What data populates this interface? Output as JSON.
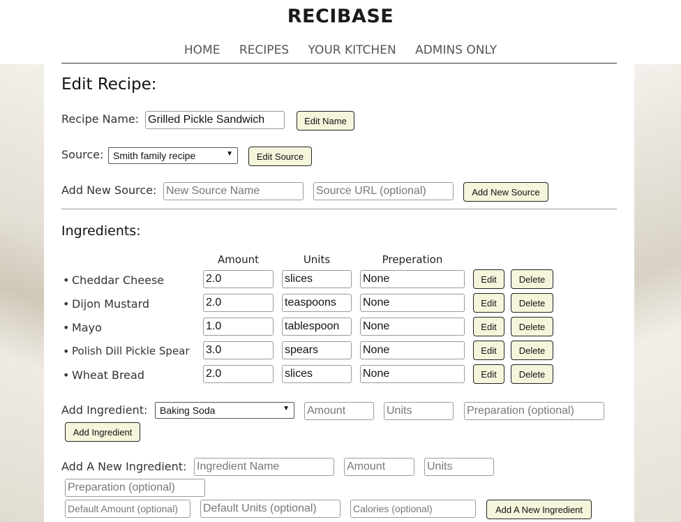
{
  "site": {
    "title": "RECIBASE"
  },
  "nav": {
    "items": [
      "HOME",
      "RECIPES",
      "YOUR KITCHEN",
      "ADMINS ONLY"
    ]
  },
  "page": {
    "heading": "Edit Recipe:"
  },
  "recipe_name": {
    "label": "Recipe Name:",
    "value": "Grilled Pickle Sandwich",
    "button": "Edit Name"
  },
  "source": {
    "label": "Source:",
    "selected": "Smith family recipe",
    "button": "Edit Source"
  },
  "new_source": {
    "label": "Add New Source:",
    "name_placeholder": "New Source Name",
    "url_placeholder": "Source URL (optional)",
    "button": "Add New Source"
  },
  "ingredients": {
    "heading": "Ingredients:",
    "columns": [
      "Amount",
      "Units",
      "Preperation"
    ],
    "edit_label": "Edit",
    "delete_label": "Delete",
    "rows": [
      {
        "name": "Cheddar Cheese",
        "amount": "2.0",
        "units": "slices",
        "prep": "None"
      },
      {
        "name": "Dijon Mustard",
        "amount": "2.0",
        "units": "teaspoons",
        "prep": "None"
      },
      {
        "name": "Mayo",
        "amount": "1.0",
        "units": "tablespoon",
        "prep": "None"
      },
      {
        "name": "Polish Dill Pickle Spear",
        "amount": "3.0",
        "units": "spears",
        "prep": "None"
      },
      {
        "name": "Wheat Bread",
        "amount": "2.0",
        "units": "slices",
        "prep": "None"
      }
    ]
  },
  "add_ingredient": {
    "label": "Add Ingredient:",
    "selected": "Baking Soda",
    "amount_placeholder": "Amount",
    "units_placeholder": "Units",
    "prep_placeholder": "Preparation (optional)",
    "button": "Add Ingredient"
  },
  "new_ingredient": {
    "label": "Add A New Ingredient:",
    "name_placeholder": "Ingredient Name",
    "amount_placeholder": "Amount",
    "units_placeholder": "Units",
    "prep_placeholder": "Preparation (optional)",
    "default_amount_placeholder": "Default Amount (optional)",
    "default_units_placeholder": "Default Units (optional)",
    "calories_placeholder": "Calories (optional)",
    "button": "Add A New Ingredient"
  },
  "icons": {
    "dropdown": "caret-down-icon",
    "bullet": "bullet-icon"
  }
}
